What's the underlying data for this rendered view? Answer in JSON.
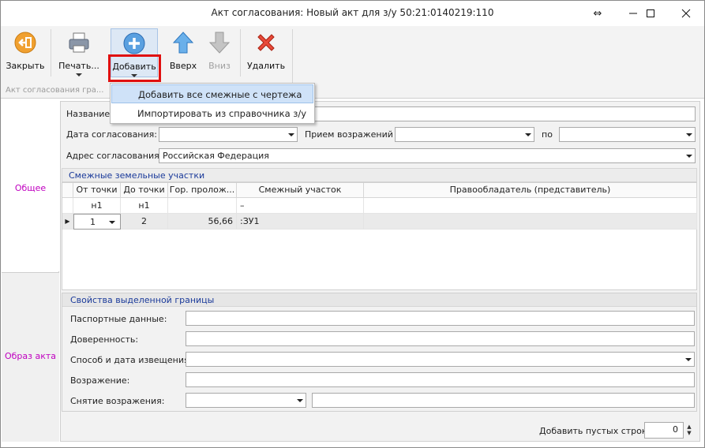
{
  "window": {
    "title": "Акт согласования: Новый акт для з/у 50:21:0140219:110",
    "controls": [
      "resize-arrows",
      "minimize",
      "maximize",
      "close"
    ]
  },
  "ribbon": {
    "buttons": {
      "close": "Закрыть",
      "print": "Печать...",
      "add": "Добавить",
      "up": "Вверх",
      "down": "Вниз",
      "delete": "Удалить"
    },
    "group_label": "Акт согласования гра...",
    "add_menu": [
      "Добавить все смежные с чертежа",
      "Импортировать из справочника з/у"
    ]
  },
  "tabs": [
    "Общее",
    "Образ акта"
  ],
  "form": {
    "name_label": "Название:",
    "name_value": "",
    "date_label": "Дата согласования:",
    "date_value": "",
    "objections_label": "Прием возражений с",
    "objections_from": "",
    "to_label": "по",
    "objections_to": "",
    "address_label": "Адрес согласования:",
    "address_value": "Российская Федерация"
  },
  "adjacent": {
    "section_title": "Смежные земельные участки",
    "columns": [
      "От точки",
      "До точки",
      "Гор. пролож...",
      "Смежный участок",
      "Правообладатель (представитель)"
    ],
    "rows": [
      {
        "from": "н1",
        "to": "н1",
        "length": "",
        "parcel": "–",
        "owner": "",
        "selected": false
      },
      {
        "from": "1",
        "to": "2",
        "length": "56,66",
        "parcel": ":ЗУ1",
        "owner": "",
        "selected": true
      }
    ]
  },
  "border_props": {
    "section_title": "Свойства выделенной границы",
    "passport_label": "Паспортные данные:",
    "passport_value": "",
    "power_label": "Доверенность:",
    "power_value": "",
    "notice_label": "Способ и дата извещения:",
    "notice_value": "",
    "objection_label": "Возражение:",
    "objection_value": "",
    "withdraw_label": "Снятие возражения:",
    "withdraw_value": "",
    "withdraw_note": ""
  },
  "footer": {
    "empty_rows_label": "Добавить пустых строк:",
    "empty_rows_value": "0"
  },
  "colors": {
    "tab_text": "#c000c0",
    "section_text": "#1a3a9a",
    "highlight_box": "#e01010",
    "menu_hover": "#cfe2f8"
  }
}
